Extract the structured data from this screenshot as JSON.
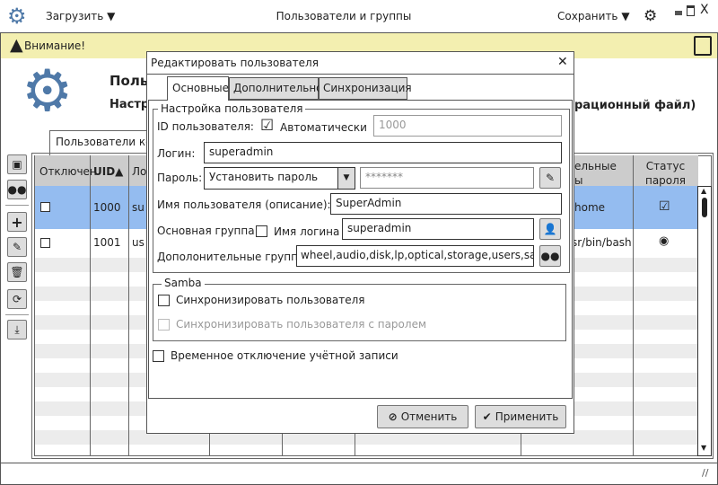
{
  "app": {
    "title": "Пользователи и группы",
    "load_label": "Загрузить",
    "save_label": "Сохранить",
    "warning": "Внимание!",
    "bg_title": "Польз",
    "bg_subtitle_left": "Настр",
    "bg_subtitle_right": "рационный файл)",
    "tab_users": "Пользователи ко"
  },
  "table": {
    "headers": [
      "Отключен",
      "UID",
      "Ло",
      "ельные",
      "ы",
      "Статус",
      "пароля"
    ],
    "rows": [
      {
        "uid": "1000",
        "login": "su",
        "shell": "home",
        "status": "checked",
        "selected": true
      },
      {
        "uid": "1001",
        "login": "us",
        "shell": "sr/bin/bash",
        "status": "radio",
        "selected": false
      }
    ]
  },
  "dialog": {
    "title": "Редактировать пользователя",
    "tabs": [
      "Основные",
      "Дополнительно",
      "Синхронизация"
    ],
    "group_user": "Настройка пользователя",
    "id_label": "ID пользователя:",
    "auto_label": "Автоматически",
    "id_value": "1000",
    "login_label": "Логин:",
    "login_value": "superadmin",
    "password_label": "Пароль:",
    "password_mode": "Установить пароль",
    "password_value": "*******",
    "fullname_label": "Имя пользователя (описание):",
    "fullname_value": "SuperAdmin",
    "primary_group_label": "Основная группа:",
    "login_name_label": "Имя логина",
    "primary_group_value": "superadmin",
    "extra_groups_label": "Дополонительные группы:",
    "extra_groups_value": "wheel,audio,disk,lp,optical,storage,users,sam",
    "group_samba": "Samba",
    "sync_user": "Синхронизировать пользователя",
    "sync_user_pw": "Синхронизировать пользователя с паролем",
    "temp_disable": "Временное отключение учётной записи",
    "cancel": "Отменить",
    "apply": "Применить"
  },
  "colors": {
    "accent": "#4f79a8",
    "selection": "#94bcf0",
    "warning_bg": "#f3efb0"
  }
}
